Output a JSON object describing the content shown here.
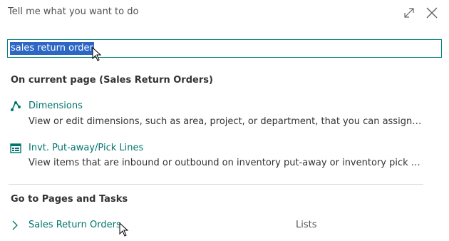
{
  "header": {
    "title": "Tell me what you want to do",
    "expand_icon": "expand-icon",
    "close_icon": "close-icon"
  },
  "search": {
    "value": "sales return order"
  },
  "current_page": {
    "heading": "On current page (Sales Return Orders)",
    "results": [
      {
        "title": "Dimensions",
        "description": "View or edit dimensions, such as area, project, or department, that you can assign to sal...",
        "icon": "dimensions-icon"
      },
      {
        "title": "Invt. Put-away/Pick Lines",
        "description": "View items that are inbound or outbound on inventory put-away or inventory pick docu...",
        "icon": "grid-lines-icon"
      }
    ]
  },
  "pages_tasks": {
    "heading": "Go to Pages and Tasks",
    "items": [
      {
        "title": "Sales Return Orders",
        "type": "Lists",
        "icon": "chevron-right-icon"
      }
    ]
  },
  "colors": {
    "accent": "#00847a",
    "link": "#00756d",
    "selection": "#2d66c4"
  }
}
